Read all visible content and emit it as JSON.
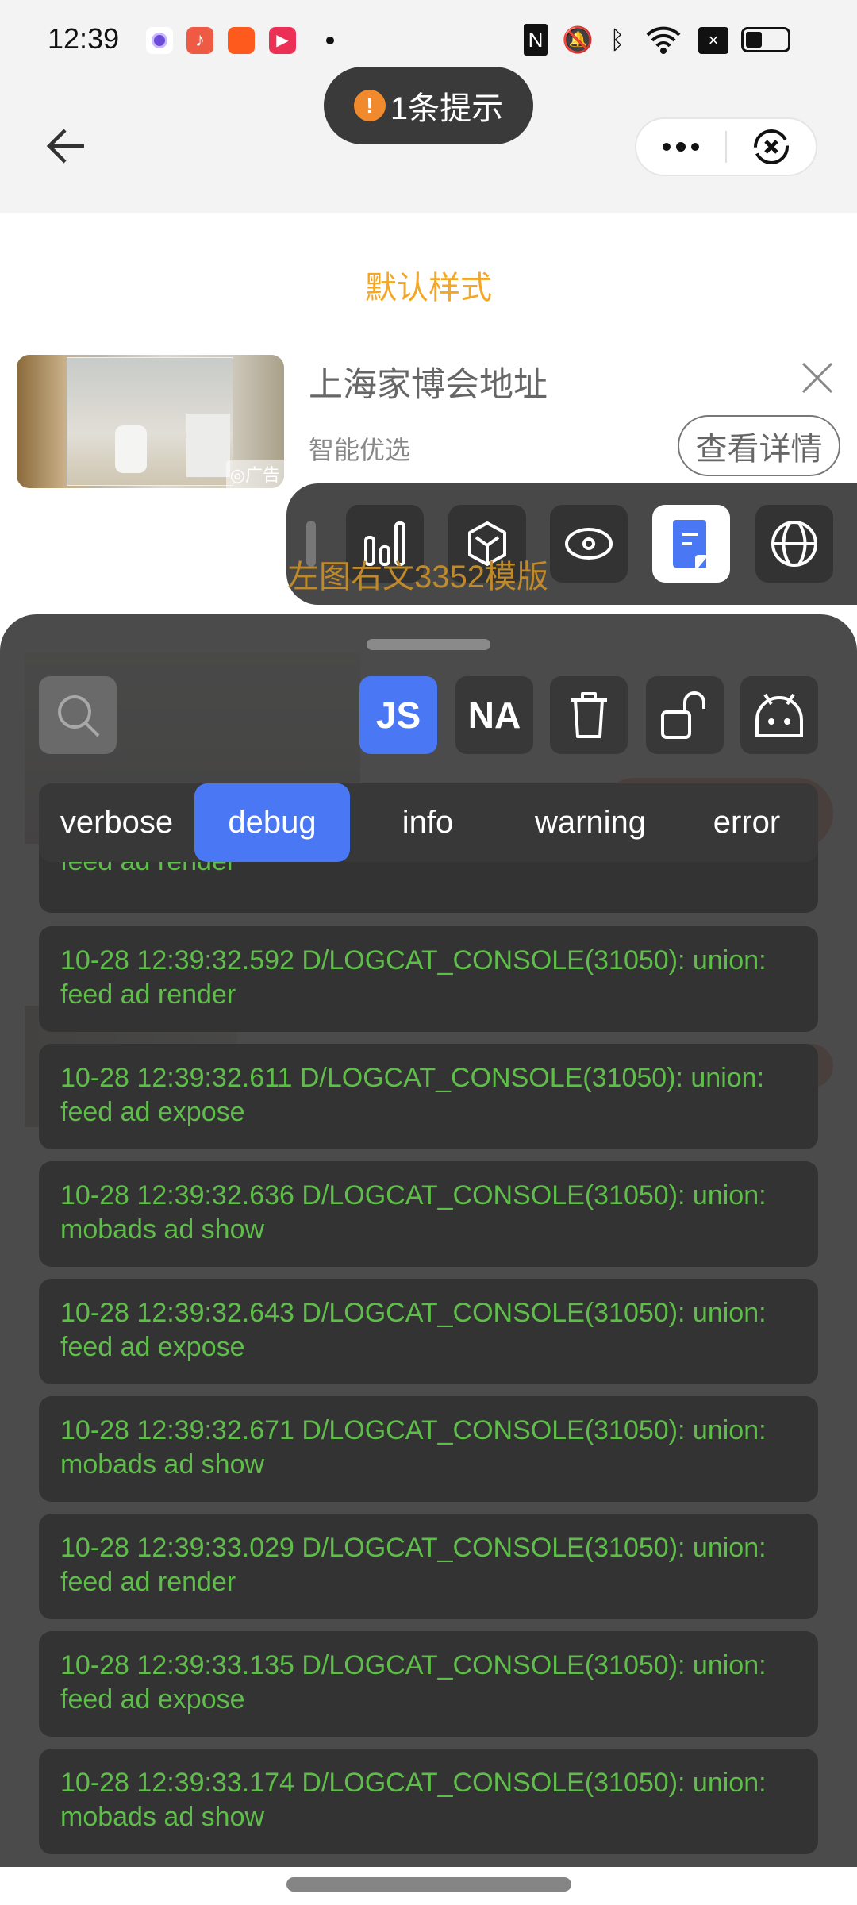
{
  "status_bar": {
    "time": "12:39",
    "app_icons": [
      "circle-app-icon",
      "music-app-icon",
      "kuaishou-icon",
      "video-play-icon"
    ],
    "system_icons": [
      "nfc-icon",
      "mute-icon",
      "bluetooth-icon",
      "wifi-icon",
      "sim-off-icon",
      "battery-icon"
    ],
    "battery_level": 0.35
  },
  "toast": {
    "text": "1条提示",
    "icon": "warning-icon",
    "color": "#f08a2c"
  },
  "header": {
    "back_icon": "back-arrow-icon",
    "more_icon": "more-icon",
    "close_icon": "close-circle-icon"
  },
  "page": {
    "title": "默认样式",
    "title_color": "#f5a623",
    "ad": {
      "title": "上海家博会地址",
      "subtitle": "智能优选",
      "button": "查看详情",
      "ad_label": "广告"
    },
    "behind_text": "左图右文3352模版"
  },
  "floating_toolbar": {
    "buttons": [
      "bar-chart-icon",
      "cube-icon",
      "eye-icon",
      "log-document-icon",
      "globe-icon"
    ],
    "active": "log-document-icon"
  },
  "console": {
    "toolbar": {
      "search_icon": "search-icon",
      "js_label": "JS",
      "na_label": "NA",
      "trash_icon": "trash-icon",
      "lock_icon": "unlock-icon",
      "android_icon": "android-icon",
      "active": "JS"
    },
    "levels": [
      "verbose",
      "debug",
      "info",
      "warning",
      "error"
    ],
    "active_level": "debug",
    "accent": "#4a78f5",
    "log_color": "#5fbe4a",
    "partial_log": "feed ad render",
    "logs": [
      {
        "line1": "10-28 12:39:32.592 D/LOGCAT_CONSOLE(31050): union:",
        "line2": "feed ad render"
      },
      {
        "line1": "10-28 12:39:32.611 D/LOGCAT_CONSOLE(31050): union:",
        "line2": "feed ad expose"
      },
      {
        "line1": "10-28 12:39:32.636 D/LOGCAT_CONSOLE(31050): union:",
        "line2": "mobads ad show"
      },
      {
        "line1": "10-28 12:39:32.643 D/LOGCAT_CONSOLE(31050): union:",
        "line2": "feed ad expose"
      },
      {
        "line1": "10-28 12:39:32.671 D/LOGCAT_CONSOLE(31050): union:",
        "line2": "mobads ad show"
      },
      {
        "line1": "10-28 12:39:33.029 D/LOGCAT_CONSOLE(31050): union:",
        "line2": "feed ad render"
      },
      {
        "line1": "10-28 12:39:33.135 D/LOGCAT_CONSOLE(31050): union:",
        "line2": "feed ad expose"
      },
      {
        "line1": "10-28 12:39:33.174 D/LOGCAT_CONSOLE(31050): union:",
        "line2": "mobads ad show"
      }
    ]
  }
}
